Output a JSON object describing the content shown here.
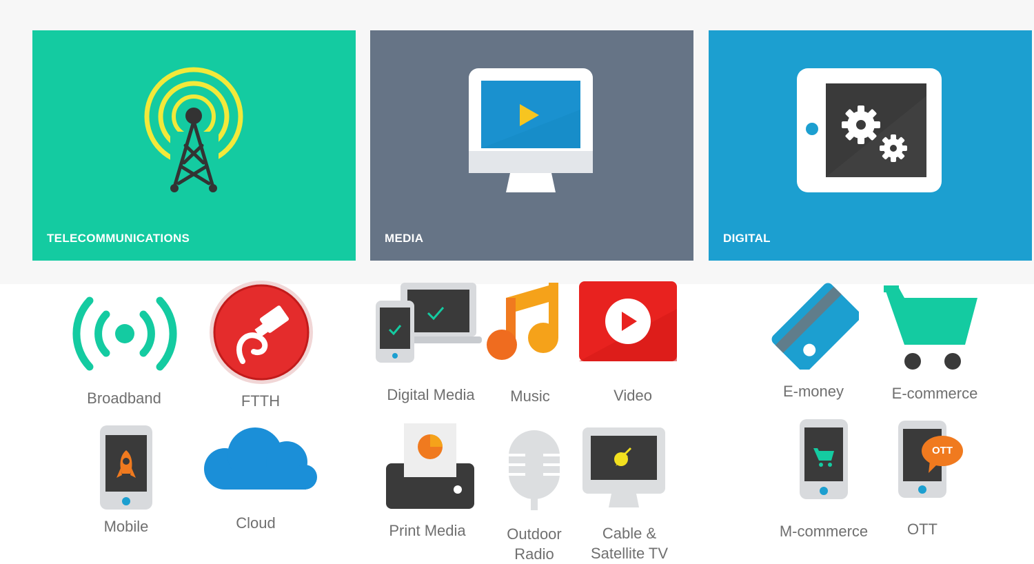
{
  "tiles": [
    {
      "label": "TELECOMMUNICATIONS",
      "color": "#14cba1",
      "icon": "antenna-tower-icon"
    },
    {
      "label": "MEDIA",
      "color": "#667486",
      "icon": "monitor-play-icon"
    },
    {
      "label": "DIGITAL",
      "color": "#1c9fd0",
      "icon": "tablet-gears-icon"
    }
  ],
  "telecom_services": {
    "broadband": "Broadband",
    "ftth": "FTTH",
    "mobile": "Mobile",
    "cloud": "Cloud"
  },
  "media_services": {
    "digital_media": "Digital Media",
    "music": "Music",
    "video": "Video",
    "print_media": "Print Media",
    "outdoor_radio_line1": "Outdoor",
    "outdoor_radio_line2": "Radio",
    "cable_tv_line1": "Cable &",
    "cable_tv_line2": "Satellite TV"
  },
  "digital_services": {
    "emoney": "E-money",
    "ecommerce": "E-commerce",
    "mcommerce": "M-commerce",
    "ott": "OTT",
    "ott_badge": "OTT"
  }
}
